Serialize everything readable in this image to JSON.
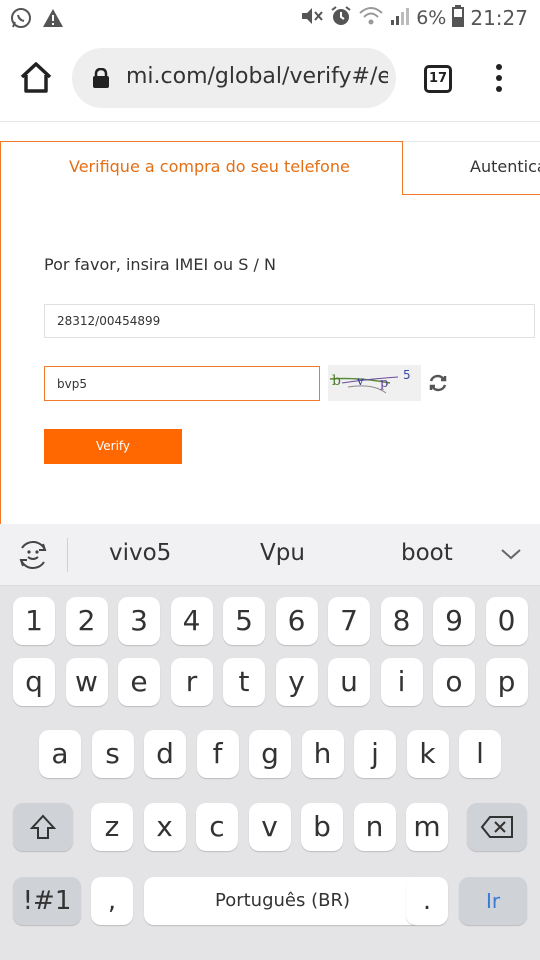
{
  "status_bar": {
    "left_icons": [
      "whatsapp-icon",
      "warning-icon"
    ],
    "right_icons": [
      "mute-icon",
      "alarm-icon",
      "wifi-icon",
      "signal-icon",
      "battery-icon"
    ],
    "battery": "6%",
    "time": "21:27"
  },
  "browser": {
    "url": "mi.com/global/verify#/e",
    "tab_count": "17"
  },
  "page": {
    "tab_active": "Verifique a compra do seu telefone",
    "tab_other": "Autentica",
    "prompt": "Por favor, insira IMEI ou S / N",
    "imei_value": "28312/00454899",
    "captcha_value": "bvp5",
    "captcha_chars": [
      "b",
      "v",
      "p",
      "5"
    ],
    "verify_label": "Verify",
    "accent": "#ff6700"
  },
  "keyboard": {
    "suggestions": [
      "vivo5",
      "Vpu",
      "boot"
    ],
    "row_numbers": [
      "1",
      "2",
      "3",
      "4",
      "5",
      "6",
      "7",
      "8",
      "9",
      "0"
    ],
    "row_1": [
      "q",
      "w",
      "e",
      "r",
      "t",
      "y",
      "u",
      "i",
      "o",
      "p"
    ],
    "row_2": [
      "a",
      "s",
      "d",
      "f",
      "g",
      "h",
      "j",
      "k",
      "l"
    ],
    "row_3": [
      "z",
      "x",
      "c",
      "v",
      "b",
      "n",
      "m"
    ],
    "symbols_label": "!#1",
    "comma_label": ",",
    "space_label": "Português (BR)",
    "period_label": ".",
    "go_label": "Ir"
  }
}
